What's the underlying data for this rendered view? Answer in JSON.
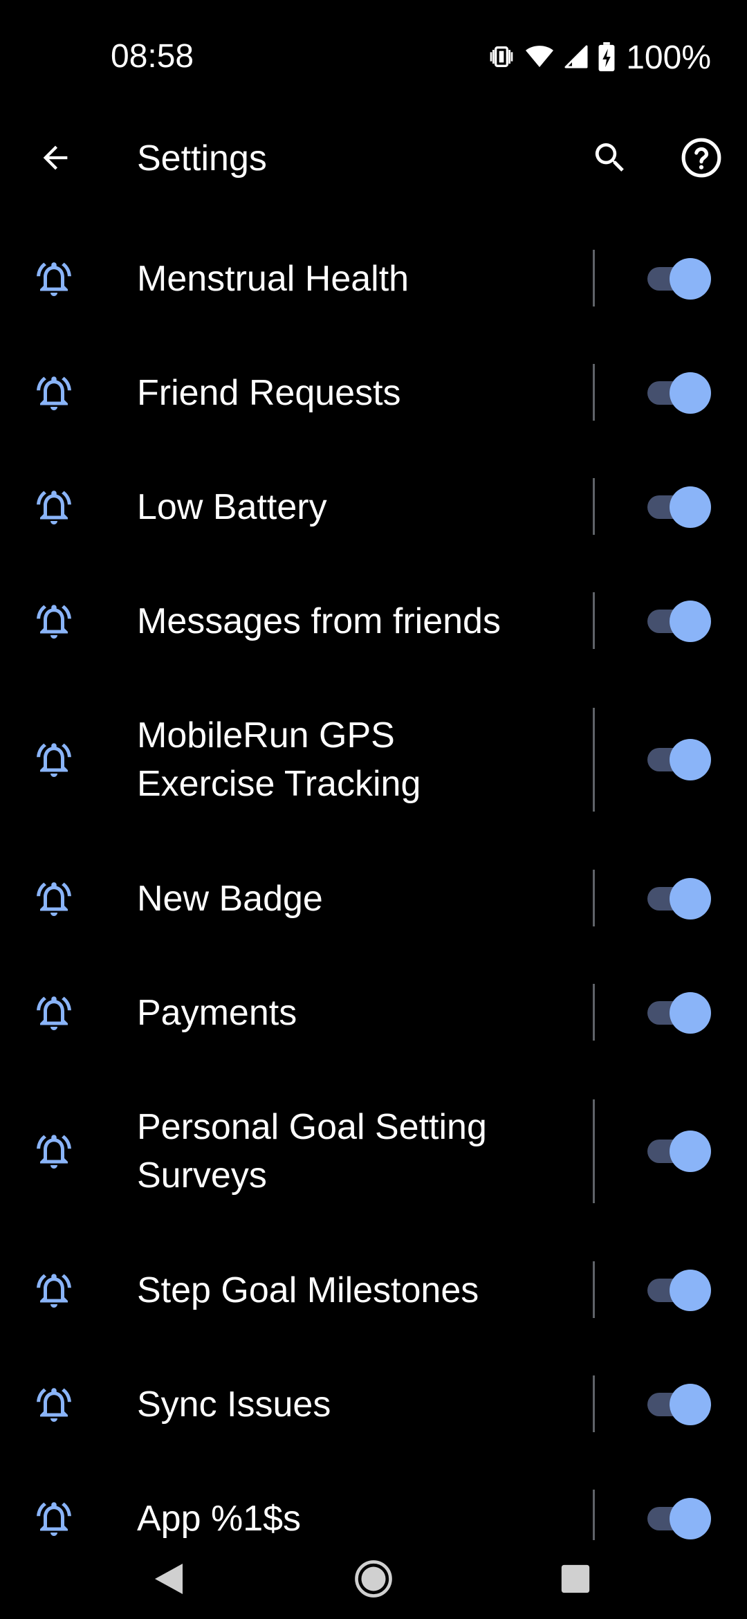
{
  "status_bar": {
    "time": "08:58",
    "battery_percent": "100%",
    "icons": [
      "vibrate-icon",
      "wifi-icon",
      "cell-signal-icon",
      "battery-charging-icon"
    ]
  },
  "app_bar": {
    "title": "Settings",
    "back_icon": "arrow-back-icon",
    "search_icon": "search-icon",
    "help_icon": "help-icon"
  },
  "colors": {
    "background": "#000000",
    "accent": "#8ab4f8",
    "toggle_track": "#45506e",
    "divider": "#5f6368",
    "text": "#ffffff"
  },
  "notifications": {
    "items": [
      {
        "label": "Menstrual Health",
        "enabled": true
      },
      {
        "label": "Friend Requests",
        "enabled": true
      },
      {
        "label": "Low Battery",
        "enabled": true
      },
      {
        "label": "Messages from friends",
        "enabled": true
      },
      {
        "label": "MobileRun GPS Exercise Tracking",
        "enabled": true
      },
      {
        "label": "New Badge",
        "enabled": true
      },
      {
        "label": "Payments",
        "enabled": true
      },
      {
        "label": "Personal Goal Setting Surveys",
        "enabled": true
      },
      {
        "label": "Step Goal Milestones",
        "enabled": true
      },
      {
        "label": "Sync Issues",
        "enabled": true
      },
      {
        "label": "App %1$s",
        "enabled": true
      }
    ]
  },
  "nav_bar": {
    "icons": [
      "nav-back-icon",
      "nav-home-icon",
      "nav-recents-icon"
    ]
  }
}
